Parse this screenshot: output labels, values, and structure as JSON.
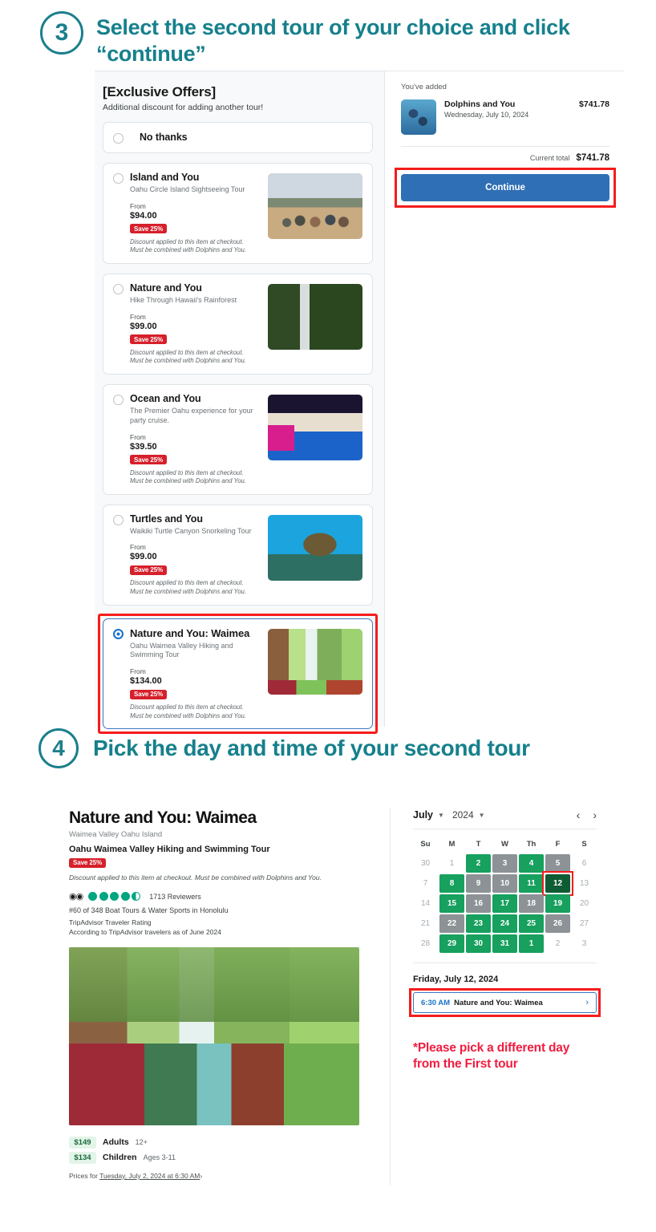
{
  "steps": {
    "three": {
      "number": "3",
      "title": "Select the second tour of your choice and click “continue”"
    },
    "four": {
      "number": "4",
      "title": "Pick the day and time of your second tour"
    }
  },
  "offers": {
    "heading": "[Exclusive Offers]",
    "subheading": "Additional discount for adding another tour!",
    "no_thanks_label": "No thanks",
    "from_label": "From",
    "save_badge": "Save 25%",
    "fine_print_line1": "Discount applied to this item at checkout.",
    "fine_print_line2": "Must be combined with Dolphins and You.",
    "items": [
      {
        "name": "Island and You",
        "desc": "Oahu Circle Island Sightseeing Tour",
        "price": "$94.00",
        "thumb": "island-thumb"
      },
      {
        "name": "Nature and You",
        "desc": "Hike Through Hawaii's Rainforest",
        "price": "$99.00",
        "thumb": "nature-thumb"
      },
      {
        "name": "Ocean and You",
        "desc": "The Premier Oahu experience for your party cruise.",
        "price": "$39.50",
        "thumb": "ocean-thumb"
      },
      {
        "name": "Turtles and You",
        "desc": "Waikiki Turtle Canyon Snorkeling Tour",
        "price": "$99.00",
        "thumb": "turtles-thumb"
      },
      {
        "name": "Nature and You: Waimea",
        "desc": "Oahu Waimea Valley Hiking and Swimming Tour",
        "price": "$134.00",
        "thumb": "waimea-thumb"
      }
    ]
  },
  "cart": {
    "added_label": "You've added",
    "item_title": "Dolphins and You",
    "item_date": "Wednesday, July 10, 2024",
    "item_price": "$741.78",
    "total_label": "Current total",
    "total_value": "$741.78",
    "continue_label": "Continue"
  },
  "detail": {
    "title": "Nature and You: Waimea",
    "location": "Waimea Valley Oahu Island",
    "subtitle": "Oahu Waimea Valley Hiking and Swimming Tour",
    "save_badge": "Save 25%",
    "fine_print": "Discount applied to this item at checkout. Must be combined with Dolphins and You.",
    "reviewers": "1713 Reviewers",
    "rank": "#60 of 348 Boat Tours & Water Sports in Honolulu",
    "rating_label": "TripAdvisor Traveler Rating",
    "rating_note": "According to TripAdvisor travelers as of June 2024",
    "prices": [
      {
        "amount": "$149",
        "who": "Adults",
        "age": "12+"
      },
      {
        "amount": "$134",
        "who": "Children",
        "age": "Ages 3-11"
      }
    ],
    "price_footer_prefix": "Prices for ",
    "price_footer_link": "Tuesday, July 2, 2024 at 6:30 AM",
    "price_footer_arrow": "›"
  },
  "calendar": {
    "month": "July",
    "year": "2024",
    "prev_label": "‹",
    "next_label": "›",
    "dow": [
      "Su",
      "M",
      "T",
      "W",
      "Th",
      "F",
      "S"
    ],
    "cells": [
      {
        "d": "30",
        "s": "muted"
      },
      {
        "d": "1",
        "s": "muted"
      },
      {
        "d": "2",
        "s": "avail"
      },
      {
        "d": "3",
        "s": "gray"
      },
      {
        "d": "4",
        "s": "avail"
      },
      {
        "d": "5",
        "s": "gray"
      },
      {
        "d": "6",
        "s": "muted"
      },
      {
        "d": "7",
        "s": "muted"
      },
      {
        "d": "8",
        "s": "avail"
      },
      {
        "d": "9",
        "s": "gray"
      },
      {
        "d": "10",
        "s": "gray"
      },
      {
        "d": "11",
        "s": "avail"
      },
      {
        "d": "12",
        "s": "selected"
      },
      {
        "d": "13",
        "s": "muted"
      },
      {
        "d": "14",
        "s": "muted"
      },
      {
        "d": "15",
        "s": "avail"
      },
      {
        "d": "16",
        "s": "gray"
      },
      {
        "d": "17",
        "s": "avail"
      },
      {
        "d": "18",
        "s": "gray"
      },
      {
        "d": "19",
        "s": "avail"
      },
      {
        "d": "20",
        "s": "muted"
      },
      {
        "d": "21",
        "s": "muted"
      },
      {
        "d": "22",
        "s": "gray"
      },
      {
        "d": "23",
        "s": "avail"
      },
      {
        "d": "24",
        "s": "avail"
      },
      {
        "d": "25",
        "s": "avail"
      },
      {
        "d": "26",
        "s": "gray"
      },
      {
        "d": "27",
        "s": "muted"
      },
      {
        "d": "28",
        "s": "muted"
      },
      {
        "d": "29",
        "s": "avail"
      },
      {
        "d": "30",
        "s": "avail"
      },
      {
        "d": "31",
        "s": "avail"
      },
      {
        "d": "1",
        "s": "avail"
      },
      {
        "d": "2",
        "s": "muted"
      },
      {
        "d": "3",
        "s": "muted"
      }
    ],
    "selected_date": "Friday, July 12, 2024",
    "slot_time": "6:30 AM",
    "slot_name": "Nature and You: Waimea",
    "slot_arrow": "›"
  },
  "warning": "*Please pick a different day from the First tour",
  "colors": {
    "teal": "#16808c",
    "blue_button": "#2f6fb5",
    "red_highlight": "#f51c1c",
    "save_red": "#d6202b",
    "cal_green": "#17a05e",
    "cal_gray": "#8c9296",
    "cal_selected": "#0d5c34",
    "warn_red": "#f01c3f"
  }
}
